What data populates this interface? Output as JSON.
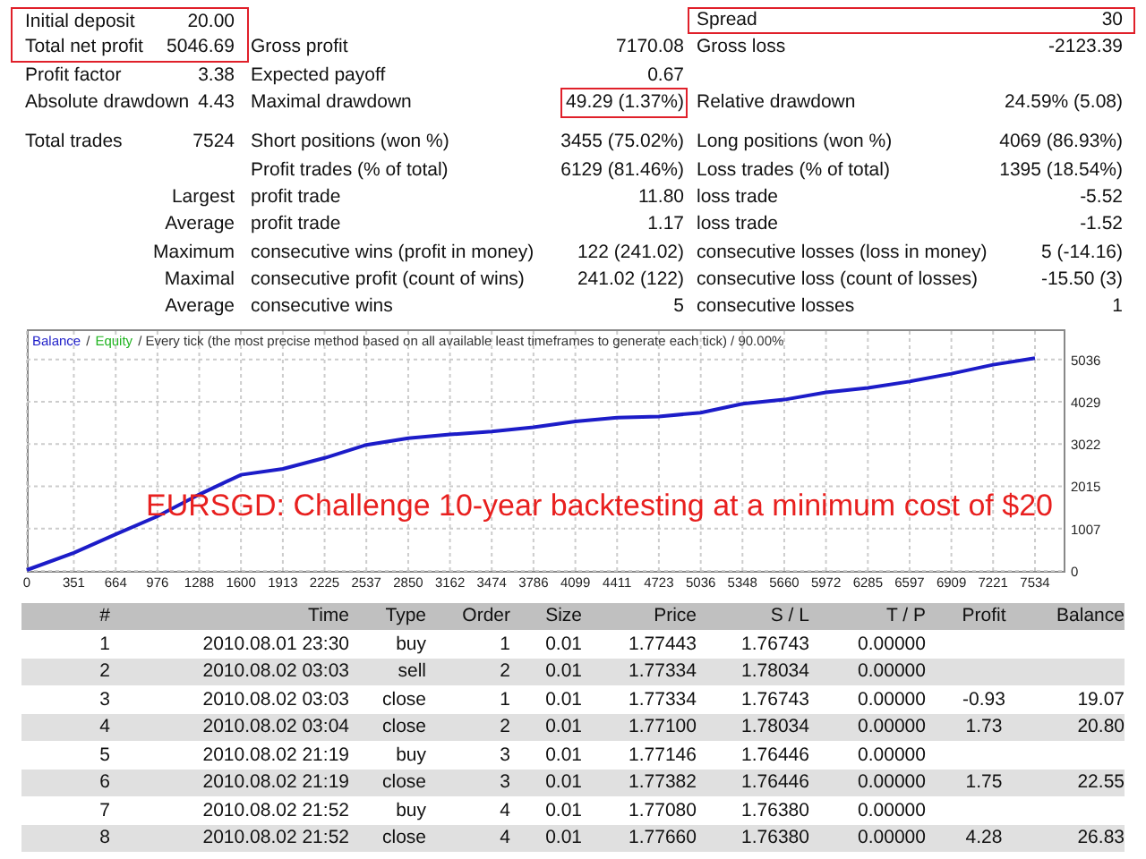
{
  "summary": {
    "rows": [
      {
        "label": "Initial deposit",
        "value": "20.00",
        "label_3": "Spread",
        "value_3": "30",
        "pair_1_boxed_top": true,
        "pair_3_boxed": true
      },
      {
        "label": "Total net profit",
        "value": "5046.69",
        "label_2": "Gross profit",
        "value_2": "7170.08",
        "label_3": "Gross loss",
        "value_3": "-2123.39",
        "pair_1_boxed_bottom": true
      },
      {
        "label": "Profit factor",
        "value": "3.38",
        "label_2": "Expected payoff",
        "value_2": "0.67"
      },
      {
        "label": "Absolute drawdown",
        "value": "4.43",
        "label_2": "Maximal drawdown",
        "value_2": "49.29 (1.37%)",
        "label_3": "Relative drawdown",
        "value_3": "24.59% (5.08)",
        "value_2_boxed": true
      },
      {
        "label": "Total trades",
        "value": "7524",
        "label_2": "Short positions (won %)",
        "value_2": "3455 (75.02%)",
        "label_3": "Long positions (won %)",
        "value_3": "4069 (86.93%)",
        "gap_before": true
      },
      {
        "label_2": "Profit trades (% of total)",
        "value_2": "6129 (81.46%)",
        "label_3": "Loss trades (% of total)",
        "value_3": "1395 (18.54%)"
      },
      {
        "value": "Largest",
        "label_2": "profit trade",
        "value_2": "11.80",
        "label_3": "loss trade",
        "value_3": "-5.52"
      },
      {
        "value": "Average",
        "label_2": "profit trade",
        "value_2": "1.17",
        "label_3": "loss trade",
        "value_3": "-1.52"
      },
      {
        "value": "Maximum",
        "label_2": "consecutive wins (profit in money)",
        "value_2": "122 (241.02)",
        "label_3": "consecutive losses (loss in money)",
        "value_3": "5 (-14.16)"
      },
      {
        "value": "Maximal",
        "label_2": "consecutive profit (count of wins)",
        "value_2": "241.02 (122)",
        "label_3": "consecutive loss (count of losses)",
        "value_3": "-15.50 (3)"
      },
      {
        "value": "Average",
        "label_2": "consecutive wins",
        "value_2": "5",
        "label_3": "consecutive losses",
        "value_3": "1"
      }
    ]
  },
  "chart": {
    "legend": [
      {
        "text": "/",
        "color": "#333333"
      },
      {
        "text": "Equity",
        "color": "#22b422"
      },
      {
        "text": "/ Every tick (the most precise method based on all available least timeframes to generate each tick) / 90.00%",
        "color": "#333333"
      }
    ],
    "caption": "EURSGD: Challenge 10-year backtesting at a minimum cost of $20",
    "chart_data": {
      "type": "line",
      "grid": true,
      "x": [
        0,
        351,
        664,
        976,
        1288,
        1600,
        1913,
        2225,
        2537,
        2850,
        3162,
        3474,
        3786,
        4099,
        4411,
        4723,
        5036,
        5348,
        5660,
        5972,
        6285,
        6597,
        6909,
        7221,
        7534
      ],
      "series": [
        {
          "name": "Balance",
          "color": "#1c1cc8",
          "values": [
            20,
            430,
            870,
            1300,
            1820,
            2290,
            2430,
            2690,
            3000,
            3160,
            3250,
            3320,
            3420,
            3560,
            3650,
            3680,
            3770,
            3980,
            4080,
            4250,
            4360,
            4510,
            4700,
            4910,
            5070
          ]
        }
      ],
      "xlim": [
        0,
        7748
      ],
      "ylim": [
        0,
        5713
      ],
      "xticks": [
        0,
        351,
        664,
        976,
        1288,
        1600,
        1913,
        2225,
        2537,
        2850,
        3162,
        3474,
        3786,
        4099,
        4411,
        4723,
        5036,
        5348,
        5660,
        5972,
        6285,
        6597,
        6909,
        7221,
        7534
      ],
      "yticks": [
        0,
        1007,
        2015,
        3022,
        4029,
        5036
      ]
    }
  },
  "trades": {
    "columns": [
      "#",
      "Time",
      "Type",
      "Order",
      "Size",
      "Price",
      "S / L",
      "T / P",
      "Profit",
      "Balance"
    ],
    "rows": [
      [
        "1",
        "2010.08.01 23:30",
        "buy",
        "1",
        "0.01",
        "1.77443",
        "1.76743",
        "0.00000"
      ],
      [
        "2",
        "2010.08.02 03:03",
        "sell",
        "2",
        "0.01",
        "1.77334",
        "1.78034",
        "0.00000"
      ],
      [
        "3",
        "2010.08.02 03:03",
        "close",
        "1",
        "0.01",
        "1.77334",
        "1.76743",
        "0.00000",
        "-0.93",
        "19.07"
      ],
      [
        "4",
        "2010.08.02 03:04",
        "close",
        "2",
        "0.01",
        "1.77100",
        "1.78034",
        "0.00000",
        "1.73",
        "20.80"
      ],
      [
        "5",
        "2010.08.02 21:19",
        "buy",
        "3",
        "0.01",
        "1.77146",
        "1.76446",
        "0.00000"
      ],
      [
        "6",
        "2010.08.02 21:19",
        "close",
        "3",
        "0.01",
        "1.77382",
        "1.76446",
        "0.00000",
        "1.75",
        "22.55"
      ],
      [
        "7",
        "2010.08.02 21:52",
        "buy",
        "4",
        "0.01",
        "1.77080",
        "1.76380",
        "0.00000"
      ],
      [
        "8",
        "2010.08.02 21:52",
        "close",
        "4",
        "0.01",
        "1.77660",
        "1.76380",
        "0.00000",
        "4.28",
        "26.83"
      ]
    ]
  }
}
